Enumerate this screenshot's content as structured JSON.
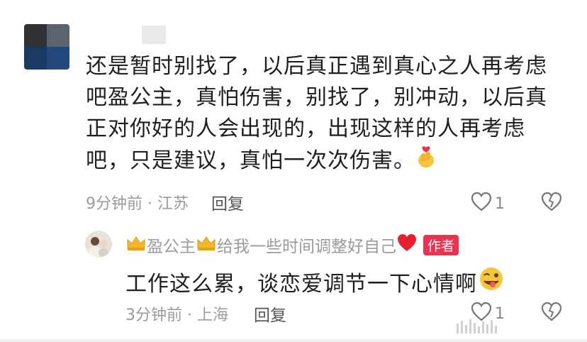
{
  "comment": {
    "avatar": "blurred-avatar",
    "text": "还是暂时别找了，以后真正遇到真心之人再考虑吧盈公主，真怕伤害，别找了，别冲动，以后真正对你好的人会出现的，出现这样的人再考虑吧，只是建议，真怕一次次伤害。",
    "emoji": "finger-heart-emoji",
    "time_location": "9分钟前 · 江苏",
    "reply_label": "回复",
    "like_count": "1",
    "like_icon": "heart-outline-icon",
    "dislike_icon": "broken-heart-icon"
  },
  "reply": {
    "username": "盈公主",
    "status": "给我一些时间调整好自己",
    "author_badge": "作者",
    "text": "工作这么累，谈恋爱调节一下心情啊",
    "emoji": "winking-tongue-emoji",
    "time_location": "3分钟前 · 上海",
    "reply_label": "回复",
    "like_count": "1",
    "like_icon": "heart-outline-icon",
    "dislike_icon": "broken-heart-icon"
  },
  "colors": {
    "text": "#1f1f1f",
    "meta": "#9a9aa0",
    "badge": "#f0304f"
  }
}
